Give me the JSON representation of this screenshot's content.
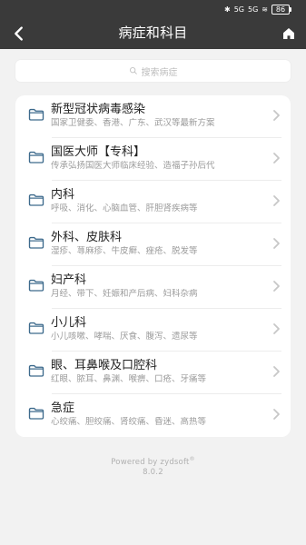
{
  "status": {
    "bluetooth": "✱",
    "sig1": "5G",
    "sig2": "5G",
    "wifi": "≋",
    "battery": "86"
  },
  "header": {
    "title": "病症和科目"
  },
  "search": {
    "placeholder": "搜索病症"
  },
  "rows": [
    {
      "title": "新型冠状病毒感染",
      "subtitle": "国家卫健委、香港、广东、武汉等最新方案"
    },
    {
      "title": "国医大师【专科】",
      "subtitle": "传承弘扬国医大师临床经验、造福子孙后代"
    },
    {
      "title": "内科",
      "subtitle": "呼吸、消化、心脑血管、肝胆肾疾病等"
    },
    {
      "title": "外科、皮肤科",
      "subtitle": "湿疹、荨麻疹、牛皮癣、痤疮、脱发等"
    },
    {
      "title": "妇产科",
      "subtitle": "月经、带下、妊娠和产后病、妇科杂病"
    },
    {
      "title": "小儿科",
      "subtitle": "小儿咳嗽、哮喘、厌食、腹泻、遗尿等"
    },
    {
      "title": "眼、耳鼻喉及口腔科",
      "subtitle": "红眼、脓耳、鼻渊、喉痹、口疮、牙痛等"
    },
    {
      "title": "急症",
      "subtitle": "心绞痛、胆绞痛、肾绞痛、昏迷、高热等"
    }
  ],
  "footer": {
    "powered_by": "Powered by zydsoft",
    "registered": "®",
    "version": "8.0.2"
  },
  "colors": {
    "header_bg": "#3a3a3a",
    "page_bg": "#f2f2f2",
    "folder_stroke": "#3d6a8c"
  }
}
